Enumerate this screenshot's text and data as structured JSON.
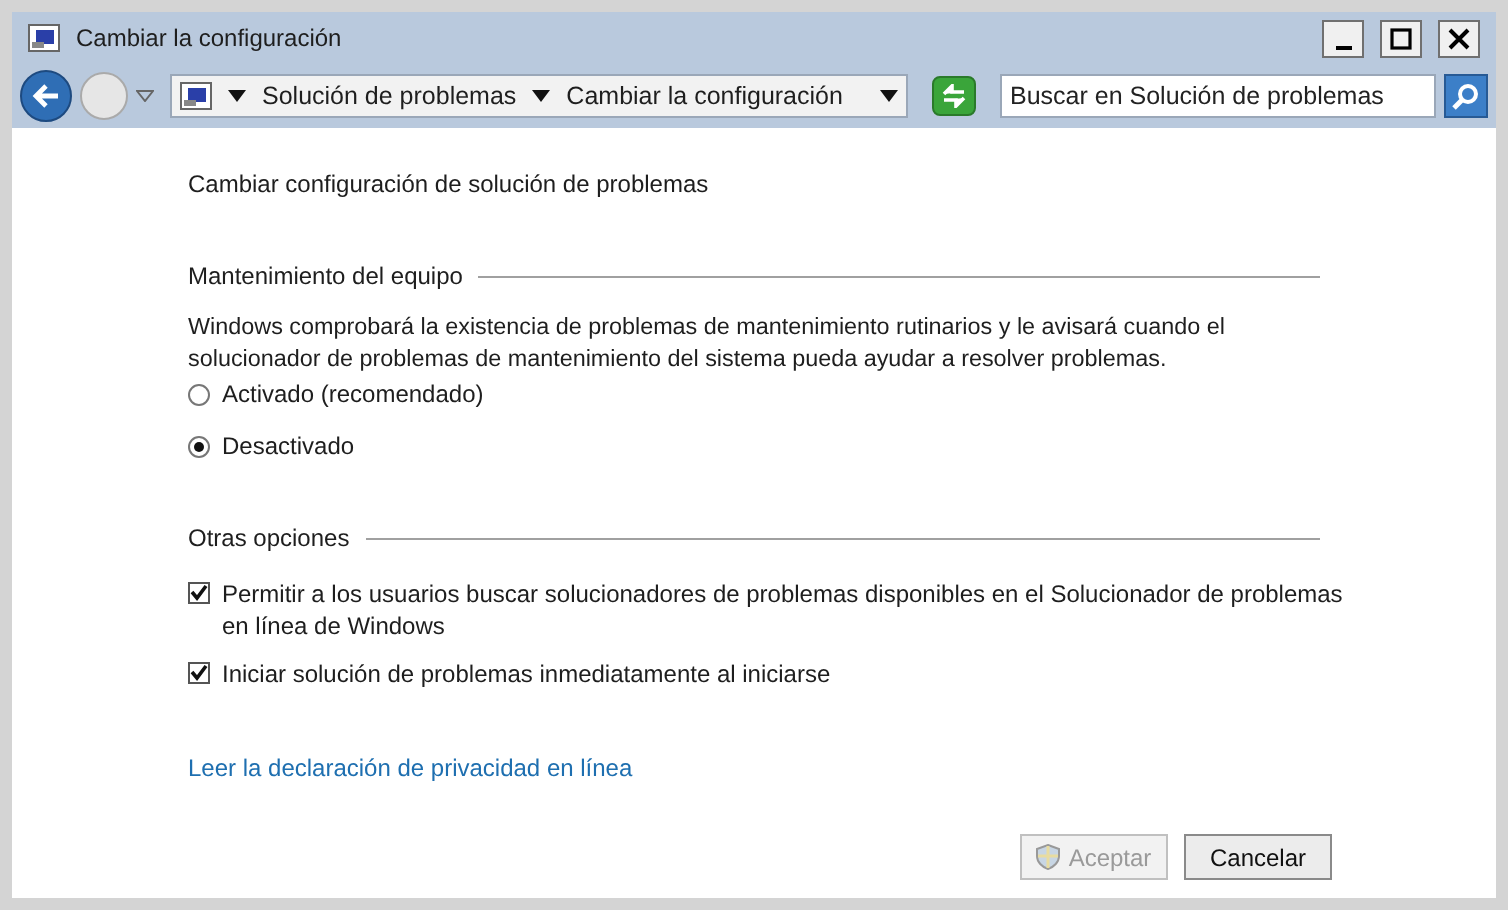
{
  "window": {
    "title": "Cambiar la configuración"
  },
  "address_bar": {
    "breadcrumbs": [
      "Solución de problemas",
      "Cambiar la configuración"
    ]
  },
  "search": {
    "placeholder": "Buscar en Solución de problemas"
  },
  "heading": "Cambiar configuración de solución de problemas",
  "maintenance": {
    "title": "Mantenimiento del equipo",
    "description": "Windows comprobará la existencia de problemas de mantenimiento rutinarios y le avisará cuando el solucionador de problemas de mantenimiento del sistema pueda ayudar a resolver problemas.",
    "options": [
      {
        "label": "Activado (recomendado)",
        "selected": false
      },
      {
        "label": "Desactivado",
        "selected": true
      }
    ]
  },
  "other": {
    "title": "Otras opciones",
    "options": [
      {
        "label": "Permitir a los usuarios buscar solucionadores de problemas disponibles en el Solucionador de problemas en línea de Windows",
        "checked": true
      },
      {
        "label": "Iniciar solución de problemas inmediatamente al iniciarse",
        "checked": true
      }
    ]
  },
  "privacy_link": "Leer la declaración de privacidad en línea",
  "buttons": [
    {
      "label": "Aceptar",
      "kind": "shield",
      "disabled": true
    },
    {
      "label": "Cancelar",
      "kind": "plain",
      "disabled": false
    }
  ]
}
